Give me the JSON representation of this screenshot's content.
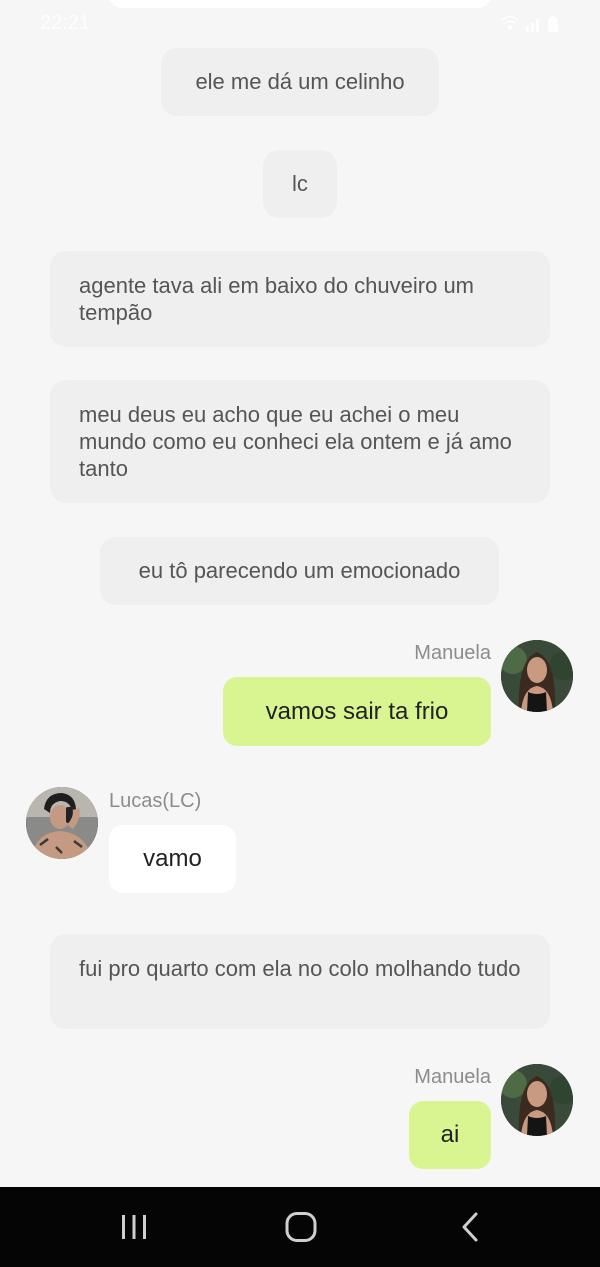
{
  "status_bar": {
    "time": "22:21",
    "wifi_icon": "wifi-icon",
    "signal_icon": "signal-icon",
    "battery_icon": "battery-icon"
  },
  "messages": [
    {
      "kind": "narration",
      "text": "ele me dá um celinho"
    },
    {
      "kind": "narration",
      "text": "lc"
    },
    {
      "kind": "narration",
      "text": "agente tava ali em baixo do chuveiro um tempão"
    },
    {
      "kind": "narration",
      "text": "meu deus eu acho que eu achei o meu mundo como eu conheci ela ontem e já amo tanto"
    },
    {
      "kind": "narration",
      "text": "eu tô parecendo um emocionado"
    },
    {
      "kind": "outgoing",
      "sender": "Manuela",
      "text": "vamos sair ta frio"
    },
    {
      "kind": "incoming",
      "sender": "Lucas(LC)",
      "text": "vamo"
    },
    {
      "kind": "narration",
      "text": "fui pro quarto com ela no colo molhando tudo"
    },
    {
      "kind": "outgoing",
      "sender": "Manuela",
      "text": "ai"
    }
  ],
  "nav_bar": {
    "recents_icon": "recents-icon",
    "home_icon": "home-icon",
    "back_icon": "back-icon"
  },
  "colors": {
    "background": "#f6f6f6",
    "narration_bubble": "#efefef",
    "outgoing_bubble": "#d9f592",
    "incoming_bubble": "#ffffff",
    "nav_bar": "#050505"
  }
}
